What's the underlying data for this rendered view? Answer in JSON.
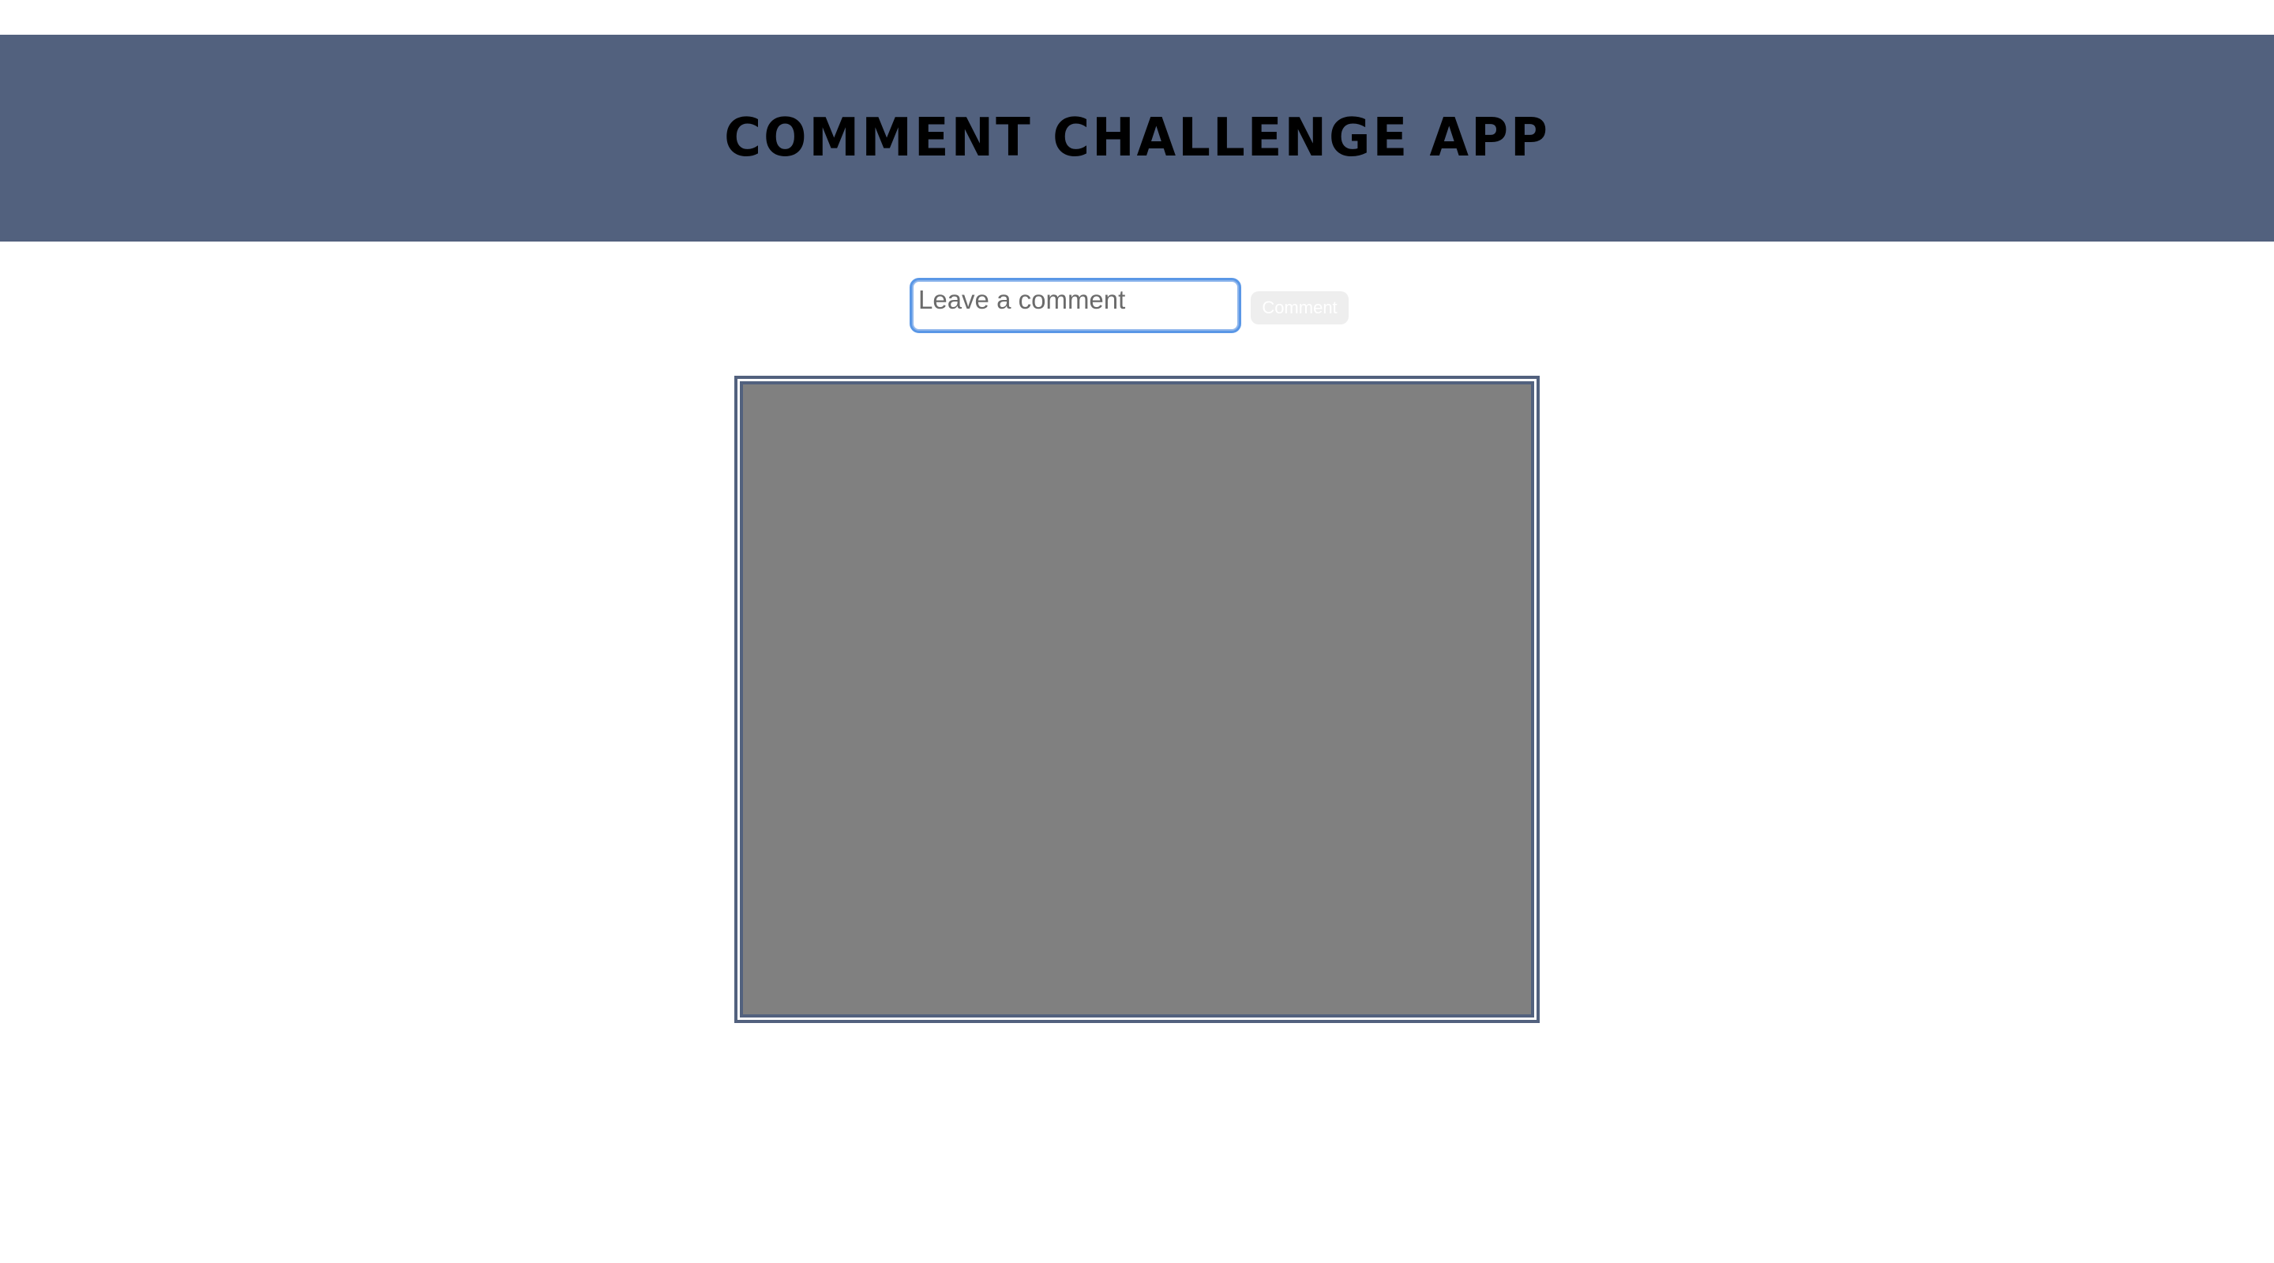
{
  "header": {
    "title": "Comment Challenge App",
    "background_color": "#52617e"
  },
  "comment_form": {
    "input_placeholder": "Leave a comment",
    "input_value": "",
    "submit_label": "Comment"
  },
  "comments_panel": {
    "background_color": "#808080",
    "border_color": "#52617e",
    "comments": []
  }
}
